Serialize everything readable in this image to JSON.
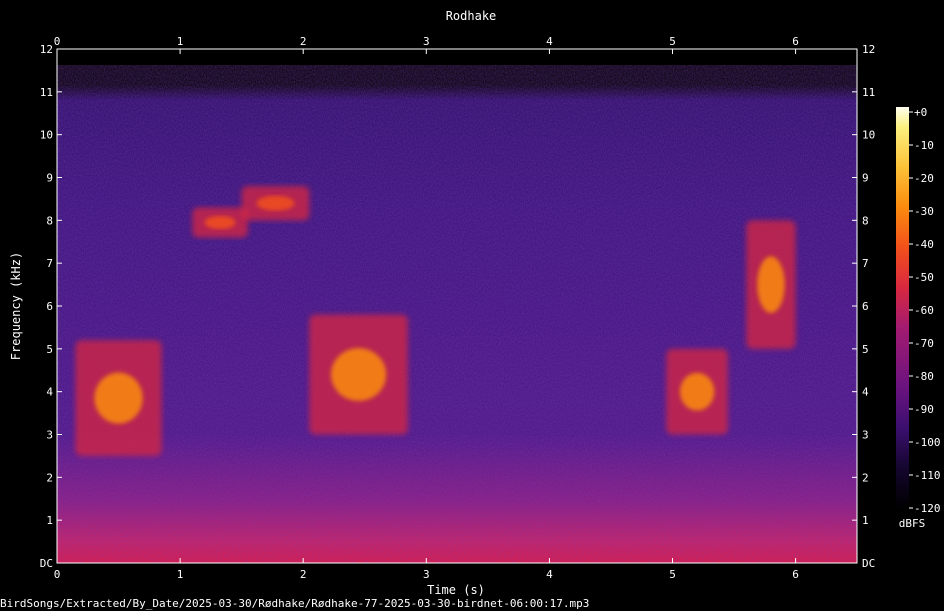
{
  "chart_data": {
    "type": "heatmap",
    "title": "Rodhake",
    "xlabel": "Time (s)",
    "ylabel": "Frequency (kHz)",
    "xlim": [
      0,
      6.5
    ],
    "ylim": [
      0,
      12
    ],
    "x_ticks": [
      "0",
      "1",
      "2",
      "3",
      "4",
      "5",
      "6"
    ],
    "y_ticks": [
      "DC",
      "1",
      "2",
      "3",
      "4",
      "5",
      "6",
      "7",
      "8",
      "9",
      "10",
      "11",
      "12"
    ],
    "colorbar": {
      "label": "dBFS",
      "range": [
        -120,
        0
      ],
      "ticks": [
        "+0",
        "-10",
        "-20",
        "-30",
        "-40",
        "-50",
        "-60",
        "-70",
        "-80",
        "-90",
        "-100",
        "-110",
        "-120"
      ],
      "colors": [
        "#000000",
        "#14062e",
        "#3b0f6f",
        "#6a137f",
        "#a31b70",
        "#d8283f",
        "#f2501b",
        "#fb8b0e",
        "#fcc238",
        "#fbf07e",
        "#fffff0"
      ]
    },
    "grid": false,
    "calls": [
      {
        "t_start": 0.15,
        "t_end": 0.85,
        "f_low": 2.5,
        "f_high": 5.2,
        "peak_db": -40
      },
      {
        "t_start": 1.1,
        "t_end": 1.55,
        "f_low": 7.6,
        "f_high": 8.3,
        "peak_db": -45
      },
      {
        "t_start": 1.5,
        "t_end": 2.05,
        "f_low": 8.0,
        "f_high": 8.8,
        "peak_db": -50
      },
      {
        "t_start": 2.05,
        "t_end": 2.85,
        "f_low": 3.0,
        "f_high": 5.8,
        "peak_db": -40
      },
      {
        "t_start": 4.95,
        "t_end": 5.45,
        "f_low": 3.0,
        "f_high": 5.0,
        "peak_db": -40
      },
      {
        "t_start": 5.6,
        "t_end": 6.0,
        "f_low": 5.0,
        "f_high": 8.0,
        "peak_db": -40
      }
    ]
  },
  "footer": {
    "filename": "BirdSongs/Extracted/By_Date/2025-03-30/Rødhake/Rødhake-77-2025-03-30-birdnet-06:00:17.mp3"
  }
}
